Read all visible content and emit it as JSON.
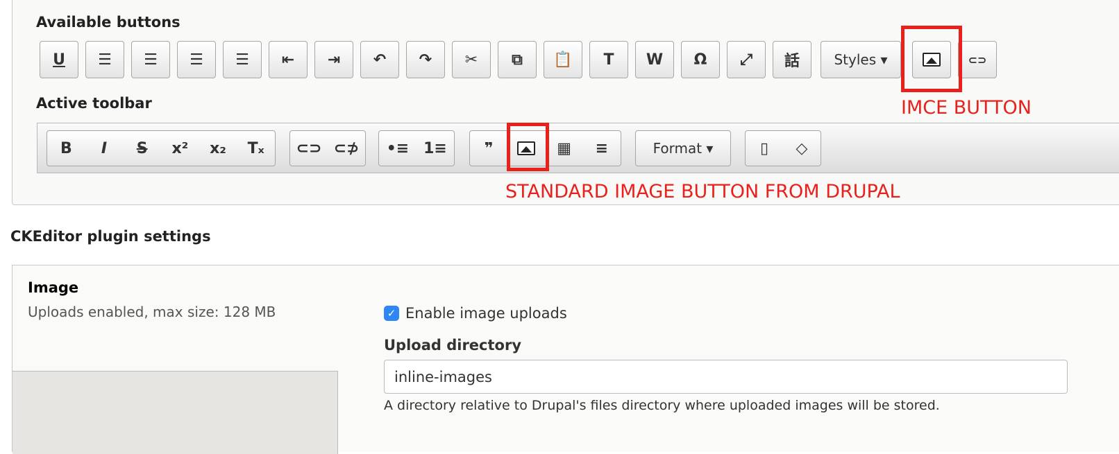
{
  "available": {
    "title": "Available buttons",
    "buttons": [
      {
        "name": "underline",
        "glyph": "U"
      },
      {
        "name": "align-left",
        "glyph": "☰"
      },
      {
        "name": "align-center",
        "glyph": "☰"
      },
      {
        "name": "align-right",
        "glyph": "☰"
      },
      {
        "name": "justify",
        "glyph": "☰"
      },
      {
        "name": "outdent",
        "glyph": "⇤"
      },
      {
        "name": "indent",
        "glyph": "⇥"
      },
      {
        "name": "undo",
        "glyph": "↶"
      },
      {
        "name": "redo",
        "glyph": "↷"
      },
      {
        "name": "cut",
        "glyph": "✂"
      },
      {
        "name": "copy",
        "glyph": "⧉"
      },
      {
        "name": "paste",
        "glyph": "📋"
      },
      {
        "name": "paste-text",
        "glyph": "T"
      },
      {
        "name": "paste-word",
        "glyph": "W"
      },
      {
        "name": "special-char",
        "glyph": "Ω"
      },
      {
        "name": "maximize",
        "glyph": "⤢"
      },
      {
        "name": "language",
        "glyph": "話"
      }
    ],
    "styles_label": "Styles ▾",
    "imce_glyph": "image",
    "link_glyph": "⊂⊃"
  },
  "active": {
    "title": "Active toolbar",
    "groups": [
      [
        "B",
        "I",
        "S",
        "x²",
        "x₂",
        "Tₓ"
      ],
      [
        "⊂⊃",
        "⊂⊅"
      ],
      [
        "•≡",
        "1≡"
      ],
      [
        "❞",
        "image",
        "▦",
        "≡"
      ],
      [
        "Format ▾"
      ],
      [
        "▯",
        "◇"
      ]
    ]
  },
  "annotations": {
    "imce": "IMCE BUTTON",
    "standard": "STANDARD IMAGE BUTTON FROM DRUPAL"
  },
  "plugins": {
    "title": "CKEditor plugin settings",
    "tab_title": "Image",
    "tab_summary": "Uploads enabled, max size: 128 MB",
    "enable_label": "Enable image uploads",
    "enable_checked": true,
    "dir_label": "Upload directory",
    "dir_value": "inline-images",
    "dir_desc": "A directory relative to Drupal's files directory where uploaded images will be stored."
  }
}
